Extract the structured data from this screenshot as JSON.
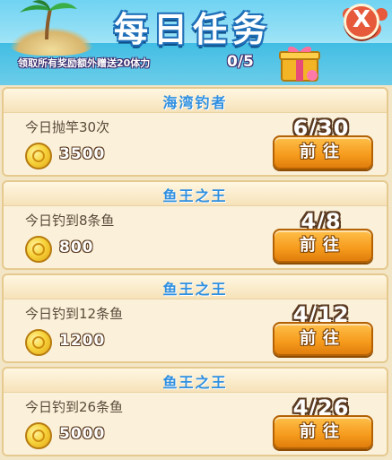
{
  "header": {
    "title": "每日任务",
    "subtitle": "领取所有奖励额外赠送20体力",
    "progress": "0/5",
    "close_label": "X"
  },
  "tasks": [
    {
      "title": "海湾钓者",
      "desc": "今日抛竿30次",
      "reward": "3500",
      "count": "6/30",
      "button": "前往"
    },
    {
      "title": "鱼王之王",
      "desc": "今日钓到8条鱼",
      "reward": "800",
      "count": "4/8",
      "button": "前往"
    },
    {
      "title": "鱼王之王",
      "desc": "今日钓到12条鱼",
      "reward": "1200",
      "count": "4/12",
      "button": "前往"
    },
    {
      "title": "鱼王之王",
      "desc": "今日钓到26条鱼",
      "reward": "5000",
      "count": "4/26",
      "button": "前往"
    }
  ],
  "colors": {
    "accent": "#2f8fe0",
    "button": "#f59a1c",
    "card": "#fbf1da"
  }
}
